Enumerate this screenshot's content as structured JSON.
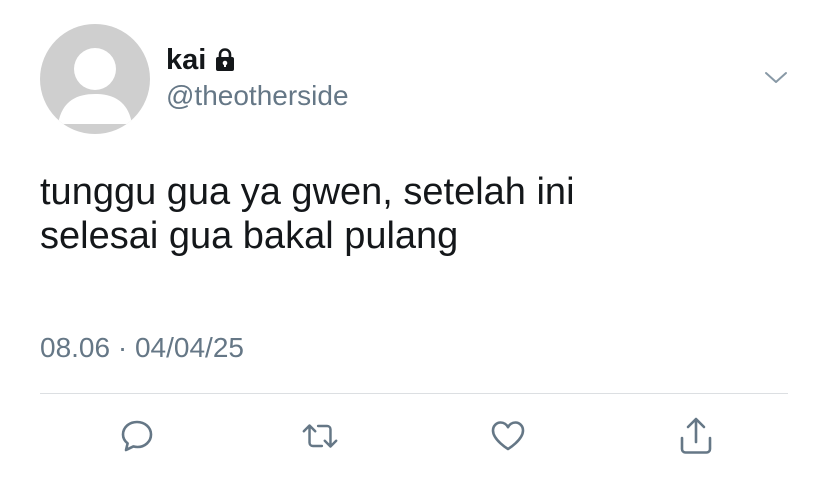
{
  "author": {
    "display_name": "kai",
    "handle": "@theotherside",
    "protected_icon": "lock-icon",
    "avatar_icon": "default-avatar-icon"
  },
  "tweet": {
    "lines": [
      "tunggu gua ya gwen, setelah ini",
      "selesai gua bakal pulang"
    ]
  },
  "meta": {
    "time": "08.06",
    "separator": " · ",
    "date": "04/04/25"
  },
  "actions": [
    {
      "icon": "reply-icon"
    },
    {
      "icon": "retweet-icon"
    },
    {
      "icon": "like-icon"
    },
    {
      "icon": "share-icon"
    }
  ],
  "colors": {
    "text": "#14171a",
    "secondary": "#657786",
    "avatar_bg": "#cfcfcf",
    "divider": "#dcdfe2"
  }
}
